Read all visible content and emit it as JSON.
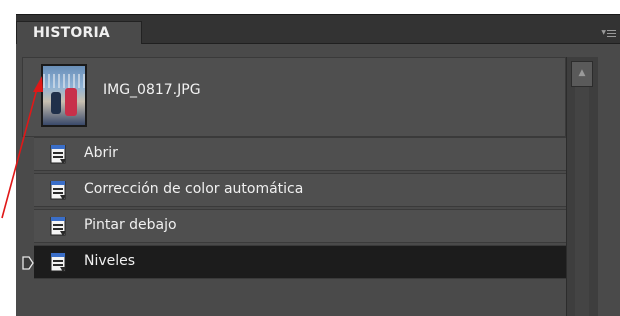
{
  "panel": {
    "tab_label": "HISTORIA",
    "menu_icon": "panel-menu-icon"
  },
  "snapshot": {
    "label": "IMG_0817.JPG",
    "thumbnail_icon": "photo-thumbnail"
  },
  "history": {
    "items": [
      {
        "label": "Abrir",
        "icon": "history-step-icon",
        "selected": false
      },
      {
        "label": "Corrección de color automática",
        "icon": "history-step-icon",
        "selected": false
      },
      {
        "label": "Pintar debajo",
        "icon": "history-step-icon",
        "selected": false
      },
      {
        "label": "Niveles",
        "icon": "history-step-icon",
        "selected": true
      }
    ],
    "state_marker_icon": "history-state-pointer-icon"
  },
  "colors": {
    "panel_bg": "#4a4a4a",
    "selected_bg": "#1c1c1c",
    "annotation_arrow": "#e01818"
  }
}
